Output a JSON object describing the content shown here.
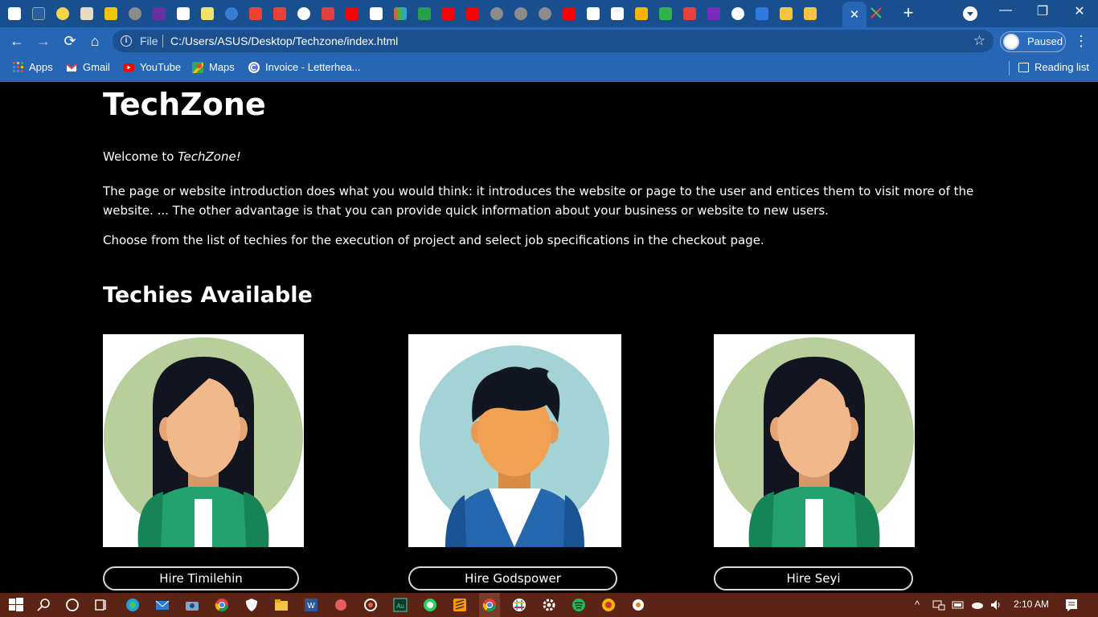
{
  "browser": {
    "active_tab_close": "✕",
    "new_tab": "+",
    "window_controls": {
      "minimize": "—",
      "restore": "❐",
      "close": "✕"
    },
    "nav": {
      "back": "←",
      "forward": "→",
      "reload": "⟳",
      "home": "⌂"
    },
    "address": {
      "scheme_label": "File",
      "url": "C:/Users/ASUS/Desktop/Techzone/index.html",
      "star": "☆"
    },
    "profile": {
      "label": "Paused"
    },
    "menu": "⋮"
  },
  "bookmarks": {
    "items": [
      {
        "label": "Apps",
        "icon": "apps-grid-icon"
      },
      {
        "label": "Gmail",
        "icon": "gmail-icon"
      },
      {
        "label": "YouTube",
        "icon": "youtube-icon"
      },
      {
        "label": "Maps",
        "icon": "maps-icon"
      },
      {
        "label": "Invoice - Letterhea...",
        "icon": "invoice-icon"
      }
    ],
    "reading_list": "Reading list"
  },
  "page": {
    "title": "TechZone",
    "welcome_prefix": "Welcome to ",
    "welcome_brand": "TechZone!",
    "intro": "The page or website introduction does what you would think: it introduces the website or page to the user and entices them to visit more of the website. ... The other advantage is that you can provide quick information about your business or website to new users.",
    "choose": "Choose from the list of techies for the execution of project and select job specifications in the checkout page.",
    "section_title": "Techies Available",
    "techies": [
      {
        "button": "Hire Timilehin",
        "avatar": "female-avatar"
      },
      {
        "button": "Hire Godspower",
        "avatar": "male-avatar"
      },
      {
        "button": "Hire Seyi",
        "avatar": "female-avatar"
      }
    ]
  },
  "taskbar": {
    "clock": "2:10 AM"
  },
  "colors": {
    "tabstrip": "#1a4f8f",
    "toolbar": "#2766b5",
    "page_bg": "#000000",
    "taskbar": "#5c2414"
  }
}
